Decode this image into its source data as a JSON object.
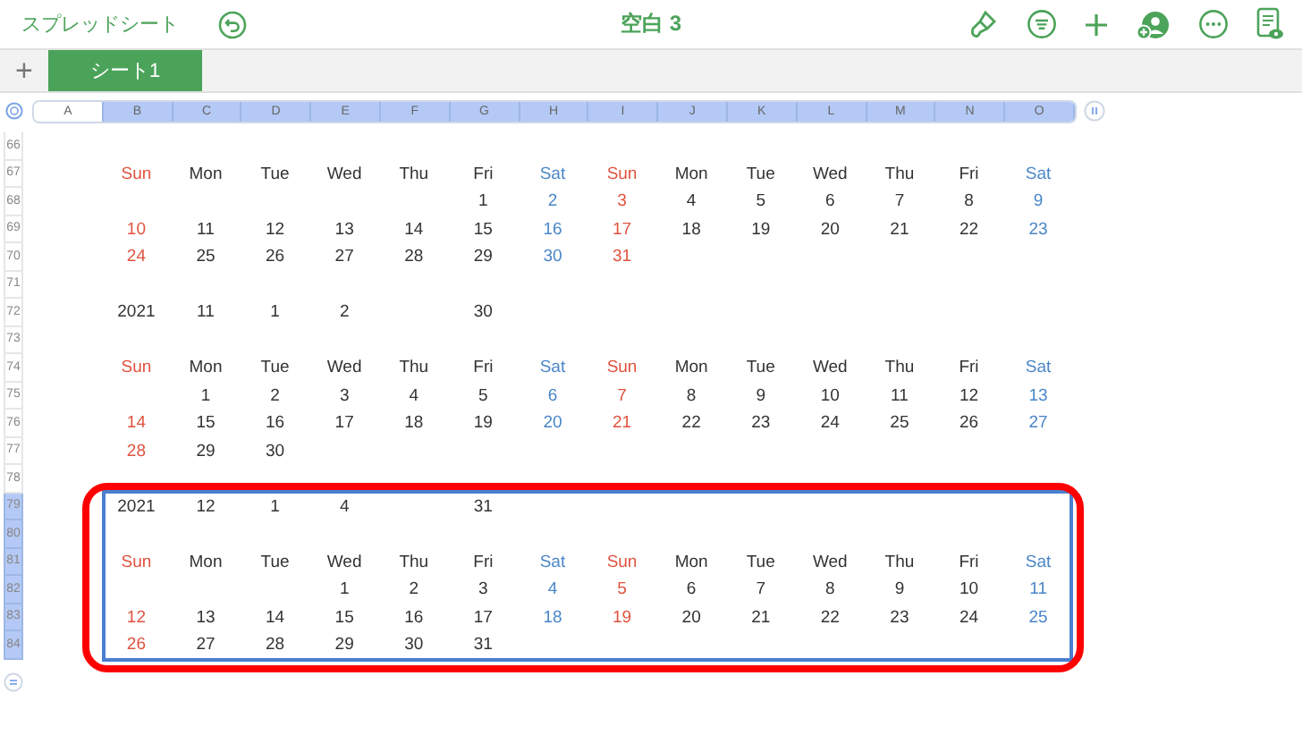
{
  "toolbar": {
    "back_label": "スプレッドシート",
    "title": "空白 3"
  },
  "sheet_tabs": {
    "add_label": "+",
    "tabs": [
      {
        "label": "シート1",
        "selected": true
      }
    ]
  },
  "columns": [
    {
      "label": "A",
      "selected": false
    },
    {
      "label": "B",
      "selected": true
    },
    {
      "label": "C",
      "selected": true
    },
    {
      "label": "D",
      "selected": true
    },
    {
      "label": "E",
      "selected": true
    },
    {
      "label": "F",
      "selected": true
    },
    {
      "label": "G",
      "selected": true
    },
    {
      "label": "H",
      "selected": true
    },
    {
      "label": "I",
      "selected": true
    },
    {
      "label": "J",
      "selected": true
    },
    {
      "label": "K",
      "selected": true
    },
    {
      "label": "L",
      "selected": true
    },
    {
      "label": "M",
      "selected": true
    },
    {
      "label": "N",
      "selected": true
    },
    {
      "label": "O",
      "selected": true
    }
  ],
  "rows": [
    {
      "number": "66",
      "selected": false
    },
    {
      "number": "67",
      "selected": false,
      "cells": [
        {
          "text": "Sun",
          "color": "#e0533f"
        },
        {
          "text": "Mon",
          "color": "#333333"
        },
        {
          "text": "Tue",
          "color": "#333333"
        },
        {
          "text": "Wed",
          "color": "#333333"
        },
        {
          "text": "Thu",
          "color": "#333333"
        },
        {
          "text": "Fri",
          "color": "#333333"
        },
        {
          "text": "Sat",
          "color": "#4a86c8"
        },
        {
          "text": "Sun",
          "color": "#e0533f"
        },
        {
          "text": "Mon",
          "color": "#333333"
        },
        {
          "text": "Tue",
          "color": "#333333"
        },
        {
          "text": "Wed",
          "color": "#333333"
        },
        {
          "text": "Thu",
          "color": "#333333"
        },
        {
          "text": "Fri",
          "color": "#333333"
        },
        {
          "text": "Sat",
          "color": "#4a86c8"
        }
      ]
    },
    {
      "number": "68",
      "selected": false,
      "cells": [
        null,
        null,
        null,
        null,
        null,
        {
          "text": "1",
          "color": "#333333"
        },
        {
          "text": "2",
          "color": "#4a86c8"
        },
        {
          "text": "3",
          "color": "#e0533f"
        },
        {
          "text": "4",
          "color": "#333333"
        },
        {
          "text": "5",
          "color": "#333333"
        },
        {
          "text": "6",
          "color": "#333333"
        },
        {
          "text": "7",
          "color": "#333333"
        },
        {
          "text": "8",
          "color": "#333333"
        },
        {
          "text": "9",
          "color": "#4a86c8"
        }
      ]
    },
    {
      "number": "69",
      "selected": false,
      "cells": [
        {
          "text": "10",
          "color": "#e0533f"
        },
        {
          "text": "11",
          "color": "#333333"
        },
        {
          "text": "12",
          "color": "#333333"
        },
        {
          "text": "13",
          "color": "#333333"
        },
        {
          "text": "14",
          "color": "#333333"
        },
        {
          "text": "15",
          "color": "#333333"
        },
        {
          "text": "16",
          "color": "#4a86c8"
        },
        {
          "text": "17",
          "color": "#e0533f"
        },
        {
          "text": "18",
          "color": "#333333"
        },
        {
          "text": "19",
          "color": "#333333"
        },
        {
          "text": "20",
          "color": "#333333"
        },
        {
          "text": "21",
          "color": "#333333"
        },
        {
          "text": "22",
          "color": "#333333"
        },
        {
          "text": "23",
          "color": "#4a86c8"
        }
      ]
    },
    {
      "number": "70",
      "selected": false,
      "cells": [
        {
          "text": "24",
          "color": "#e0533f"
        },
        {
          "text": "25",
          "color": "#333333"
        },
        {
          "text": "26",
          "color": "#333333"
        },
        {
          "text": "27",
          "color": "#333333"
        },
        {
          "text": "28",
          "color": "#333333"
        },
        {
          "text": "29",
          "color": "#333333"
        },
        {
          "text": "30",
          "color": "#4a86c8"
        },
        {
          "text": "31",
          "color": "#e0533f"
        }
      ]
    },
    {
      "number": "71",
      "selected": false
    },
    {
      "number": "72",
      "selected": false,
      "cells": [
        {
          "text": "2021",
          "color": "#333333"
        },
        {
          "text": "11",
          "color": "#333333"
        },
        {
          "text": "1",
          "color": "#333333"
        },
        {
          "text": "2",
          "color": "#333333"
        },
        null,
        {
          "text": "30",
          "color": "#333333"
        }
      ]
    },
    {
      "number": "73",
      "selected": false
    },
    {
      "number": "74",
      "selected": false,
      "cells": [
        {
          "text": "Sun",
          "color": "#e0533f"
        },
        {
          "text": "Mon",
          "color": "#333333"
        },
        {
          "text": "Tue",
          "color": "#333333"
        },
        {
          "text": "Wed",
          "color": "#333333"
        },
        {
          "text": "Thu",
          "color": "#333333"
        },
        {
          "text": "Fri",
          "color": "#333333"
        },
        {
          "text": "Sat",
          "color": "#4a86c8"
        },
        {
          "text": "Sun",
          "color": "#e0533f"
        },
        {
          "text": "Mon",
          "color": "#333333"
        },
        {
          "text": "Tue",
          "color": "#333333"
        },
        {
          "text": "Wed",
          "color": "#333333"
        },
        {
          "text": "Thu",
          "color": "#333333"
        },
        {
          "text": "Fri",
          "color": "#333333"
        },
        {
          "text": "Sat",
          "color": "#4a86c8"
        }
      ]
    },
    {
      "number": "75",
      "selected": false,
      "cells": [
        null,
        {
          "text": "1",
          "color": "#333333"
        },
        {
          "text": "2",
          "color": "#333333"
        },
        {
          "text": "3",
          "color": "#333333"
        },
        {
          "text": "4",
          "color": "#333333"
        },
        {
          "text": "5",
          "color": "#333333"
        },
        {
          "text": "6",
          "color": "#4a86c8"
        },
        {
          "text": "7",
          "color": "#e0533f"
        },
        {
          "text": "8",
          "color": "#333333"
        },
        {
          "text": "9",
          "color": "#333333"
        },
        {
          "text": "10",
          "color": "#333333"
        },
        {
          "text": "11",
          "color": "#333333"
        },
        {
          "text": "12",
          "color": "#333333"
        },
        {
          "text": "13",
          "color": "#4a86c8"
        }
      ]
    },
    {
      "number": "76",
      "selected": false,
      "cells": [
        {
          "text": "14",
          "color": "#e0533f"
        },
        {
          "text": "15",
          "color": "#333333"
        },
        {
          "text": "16",
          "color": "#333333"
        },
        {
          "text": "17",
          "color": "#333333"
        },
        {
          "text": "18",
          "color": "#333333"
        },
        {
          "text": "19",
          "color": "#333333"
        },
        {
          "text": "20",
          "color": "#4a86c8"
        },
        {
          "text": "21",
          "color": "#e0533f"
        },
        {
          "text": "22",
          "color": "#333333"
        },
        {
          "text": "23",
          "color": "#333333"
        },
        {
          "text": "24",
          "color": "#333333"
        },
        {
          "text": "25",
          "color": "#333333"
        },
        {
          "text": "26",
          "color": "#333333"
        },
        {
          "text": "27",
          "color": "#4a86c8"
        }
      ]
    },
    {
      "number": "77",
      "selected": false,
      "cells": [
        {
          "text": "28",
          "color": "#e0533f"
        },
        {
          "text": "29",
          "color": "#333333"
        },
        {
          "text": "30",
          "color": "#333333"
        }
      ]
    },
    {
      "number": "78",
      "selected": false
    },
    {
      "number": "79",
      "selected": true,
      "cells": [
        {
          "text": "2021",
          "color": "#333333"
        },
        {
          "text": "12",
          "color": "#333333"
        },
        {
          "text": "1",
          "color": "#333333"
        },
        {
          "text": "4",
          "color": "#333333"
        },
        null,
        {
          "text": "31",
          "color": "#333333"
        }
      ]
    },
    {
      "number": "80",
      "selected": true
    },
    {
      "number": "81",
      "selected": true,
      "cells": [
        {
          "text": "Sun",
          "color": "#e0533f"
        },
        {
          "text": "Mon",
          "color": "#333333"
        },
        {
          "text": "Tue",
          "color": "#333333"
        },
        {
          "text": "Wed",
          "color": "#333333"
        },
        {
          "text": "Thu",
          "color": "#333333"
        },
        {
          "text": "Fri",
          "color": "#333333"
        },
        {
          "text": "Sat",
          "color": "#4a86c8"
        },
        {
          "text": "Sun",
          "color": "#e0533f"
        },
        {
          "text": "Mon",
          "color": "#333333"
        },
        {
          "text": "Tue",
          "color": "#333333"
        },
        {
          "text": "Wed",
          "color": "#333333"
        },
        {
          "text": "Thu",
          "color": "#333333"
        },
        {
          "text": "Fri",
          "color": "#333333"
        },
        {
          "text": "Sat",
          "color": "#4a86c8"
        }
      ]
    },
    {
      "number": "82",
      "selected": true,
      "cells": [
        null,
        null,
        null,
        {
          "text": "1",
          "color": "#333333"
        },
        {
          "text": "2",
          "color": "#333333"
        },
        {
          "text": "3",
          "color": "#333333"
        },
        {
          "text": "4",
          "color": "#4a86c8"
        },
        {
          "text": "5",
          "color": "#e0533f"
        },
        {
          "text": "6",
          "color": "#333333"
        },
        {
          "text": "7",
          "color": "#333333"
        },
        {
          "text": "8",
          "color": "#333333"
        },
        {
          "text": "9",
          "color": "#333333"
        },
        {
          "text": "10",
          "color": "#333333"
        },
        {
          "text": "11",
          "color": "#4a86c8"
        }
      ]
    },
    {
      "number": "83",
      "selected": true,
      "cells": [
        {
          "text": "12",
          "color": "#e0533f"
        },
        {
          "text": "13",
          "color": "#333333"
        },
        {
          "text": "14",
          "color": "#333333"
        },
        {
          "text": "15",
          "color": "#333333"
        },
        {
          "text": "16",
          "color": "#333333"
        },
        {
          "text": "17",
          "color": "#333333"
        },
        {
          "text": "18",
          "color": "#4a86c8"
        },
        {
          "text": "19",
          "color": "#e0533f"
        },
        {
          "text": "20",
          "color": "#333333"
        },
        {
          "text": "21",
          "color": "#333333"
        },
        {
          "text": "22",
          "color": "#333333"
        },
        {
          "text": "23",
          "color": "#333333"
        },
        {
          "text": "24",
          "color": "#333333"
        },
        {
          "text": "25",
          "color": "#4a86c8"
        }
      ]
    },
    {
      "number": "84",
      "selected": true,
      "cells": [
        {
          "text": "26",
          "color": "#e0533f"
        },
        {
          "text": "27",
          "color": "#333333"
        },
        {
          "text": "28",
          "color": "#333333"
        },
        {
          "text": "29",
          "color": "#333333"
        },
        {
          "text": "30",
          "color": "#333333"
        },
        {
          "text": "31",
          "color": "#333333"
        }
      ]
    }
  ]
}
